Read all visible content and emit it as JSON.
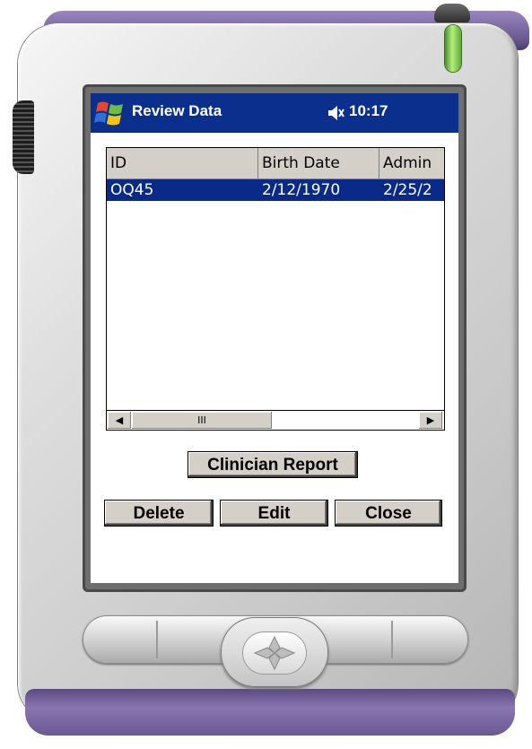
{
  "titlebar": {
    "app_title": "Review Data",
    "clock": "10:17",
    "icons": [
      "windows-start-icon",
      "speaker-muted-icon"
    ]
  },
  "listview": {
    "columns": [
      "ID",
      "Birth Date",
      "Admin"
    ],
    "rows": [
      {
        "id": "OQ45",
        "birth_date": "2/12/1970",
        "admin": "2/25/2"
      }
    ],
    "selected_row_color": "#0a2a8a",
    "scrollbar": {
      "thumb_grip": "III",
      "left_arrow": "◀",
      "right_arrow": "▶"
    }
  },
  "buttons": {
    "clinician_report": "Clinician Report",
    "delete": "Delete",
    "edit": "Edit",
    "close": "Close"
  },
  "colors": {
    "titlebar": "#0b2f8c",
    "device_purple": "#7a68a6",
    "button_face": "#d4d0c8"
  }
}
